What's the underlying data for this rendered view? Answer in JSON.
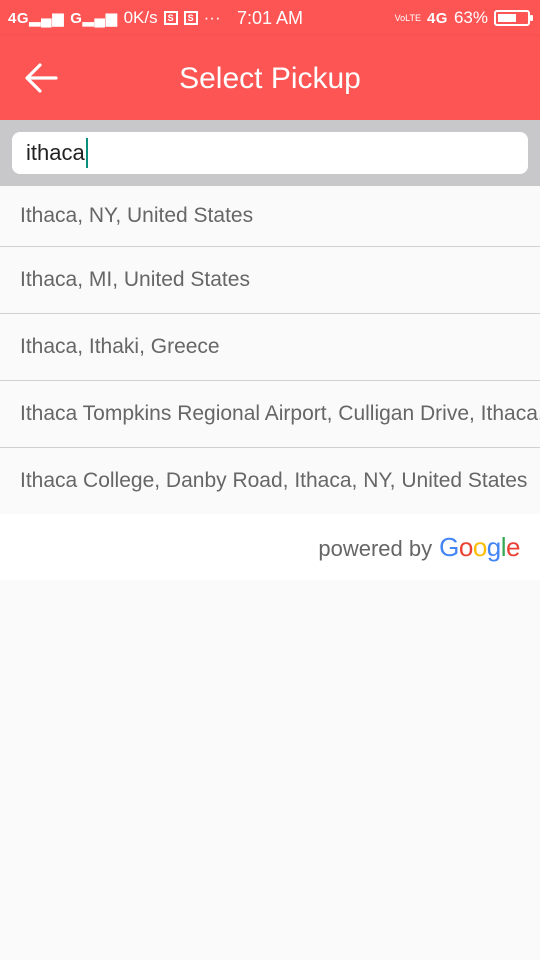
{
  "status_bar": {
    "network1": "4G",
    "network2": "G",
    "speed": "0K/s",
    "icon_s": "S",
    "more": "···",
    "time": "7:01 AM",
    "volte": "VoLTE",
    "network3": "4G",
    "battery_percent": "63%",
    "battery_level": 0.63
  },
  "app_bar": {
    "back_icon": "arrow-left-icon",
    "title": "Select Pickup",
    "color": "#fd5454"
  },
  "search": {
    "value": "ithaca",
    "caret_color": "#0a8f7c"
  },
  "results": [
    {
      "label": "Ithaca, NY, United States"
    },
    {
      "label": "Ithaca, MI, United States"
    },
    {
      "label": "Ithaca, Ithaki, Greece"
    },
    {
      "label": "Ithaca Tompkins Regional Airport, Culligan Drive, Ithaca, NY, United States"
    },
    {
      "label": "Ithaca College, Danby Road, Ithaca, NY, United States"
    }
  ],
  "attribution": {
    "prefix": "powered by",
    "logo_letters": [
      "G",
      "o",
      "o",
      "g",
      "l",
      "e"
    ],
    "logo_colors": [
      "#4285f4",
      "#ea4335",
      "#fbbc05",
      "#4285f4",
      "#34a853",
      "#ea4335"
    ]
  }
}
